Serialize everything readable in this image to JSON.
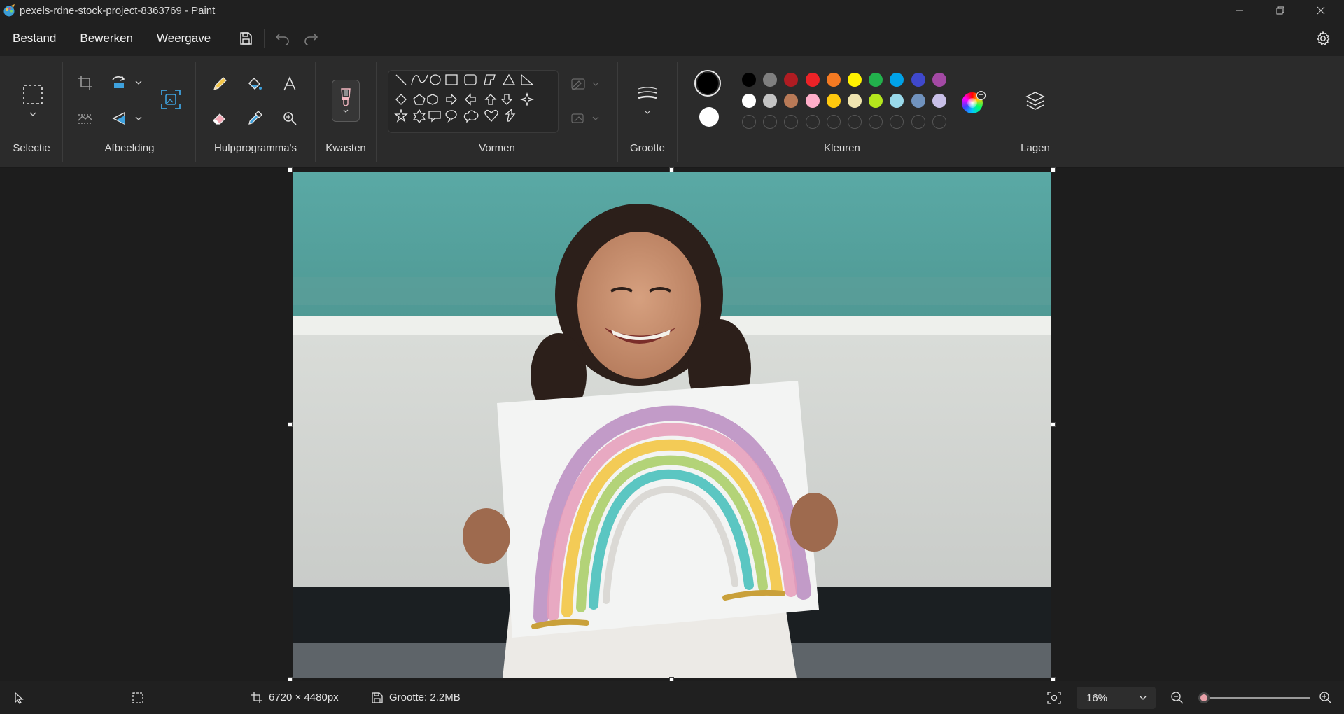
{
  "window": {
    "title": "pexels-rdne-stock-project-8363769 - Paint",
    "minimize_icon": "minimize-icon",
    "restore_icon": "restore-icon",
    "close_icon": "close-icon"
  },
  "menu": {
    "items": [
      "Bestand",
      "Bewerken",
      "Weergave"
    ],
    "save_icon": "save-icon",
    "undo_icon": "undo-icon",
    "redo_icon": "redo-icon",
    "settings_icon": "gear-icon"
  },
  "ribbon": {
    "groups": {
      "selection": "Selectie",
      "image": "Afbeelding",
      "tools": "Hulpprogramma's",
      "brushes": "Kwasten",
      "shapes": "Vormen",
      "size": "Grootte",
      "colors": "Kleuren",
      "layers": "Lagen"
    },
    "colors": {
      "primary": "#000000",
      "secondary": "#ffffff",
      "row1": [
        "#000000",
        "#7f7f7f",
        "#b01c22",
        "#ec2227",
        "#f47a22",
        "#fff200",
        "#22b14c",
        "#00a2e8",
        "#3f48cc",
        "#a349a4"
      ],
      "row2": [
        "#ffffff",
        "#c3c3c3",
        "#b97a57",
        "#ffaec9",
        "#ffc90e",
        "#efe4b0",
        "#b5e61d",
        "#99d9ea",
        "#7092be",
        "#c8bfe7"
      ],
      "row3_empty_count": 10
    }
  },
  "status": {
    "dimensions": "6720 × 4480px",
    "size": "Grootte: 2.2MB",
    "zoom": "16%",
    "zoom_level_fraction": 0.0
  }
}
